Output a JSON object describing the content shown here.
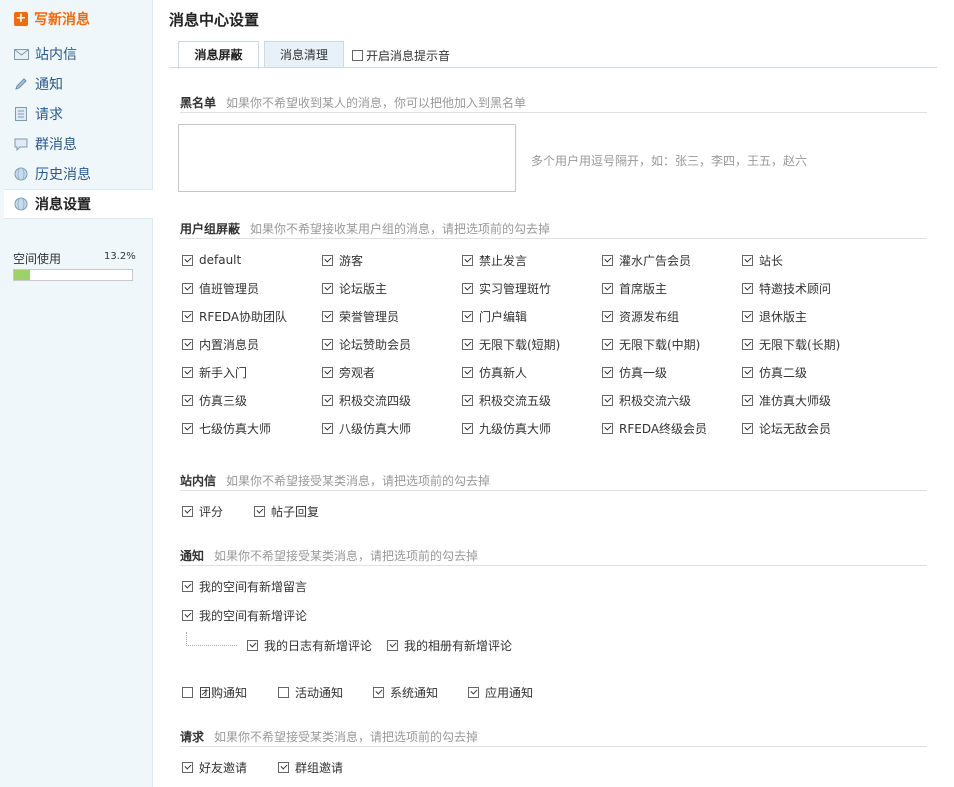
{
  "sidebar": {
    "compose_label": "写新消息",
    "items": [
      {
        "label": "站内信",
        "icon": "envelope-icon"
      },
      {
        "label": "通知",
        "icon": "pencil-icon"
      },
      {
        "label": "请求",
        "icon": "document-icon"
      },
      {
        "label": "群消息",
        "icon": "speech-bubble-icon"
      },
      {
        "label": "历史消息",
        "icon": "globe-icon"
      },
      {
        "label": "消息设置",
        "icon": "globe-icon"
      }
    ],
    "space": {
      "label": "空间使用",
      "percent_text": "13.2%",
      "percent": 13.2
    }
  },
  "main": {
    "title": "消息中心设置",
    "tabs": [
      {
        "label": "消息屏蔽"
      },
      {
        "label": "消息清理"
      }
    ],
    "sound_label": "开启消息提示音",
    "blacklist": {
      "title": "黑名单",
      "desc": "如果你不希望收到某人的消息，你可以把他加入到黑名单",
      "hint": "多个用户用逗号隔开，如：张三，李四，王五，赵六"
    },
    "group_block": {
      "title": "用户组屏蔽",
      "desc": "如果你不希望接收某用户组的消息，请把选项前的勾去掉",
      "rows": [
        [
          "default",
          "游客",
          "禁止发言",
          "灌水广告会员",
          "站长"
        ],
        [
          "值班管理员",
          "论坛版主",
          "实习管理斑竹",
          "首席版主",
          "特邀技术顾问"
        ],
        [
          "RFEDA协助团队",
          "荣誉管理员",
          "门户编辑",
          "资源发布组",
          "退休版主"
        ],
        [
          "内置消息员",
          "论坛赞助会员",
          "无限下载(短期)",
          "无限下载(中期)",
          "无限下载(长期)"
        ],
        [
          "新手入门",
          "旁观者",
          "仿真新人",
          "仿真一级",
          "仿真二级"
        ],
        [
          "仿真三级",
          "积极交流四级",
          "积极交流五级",
          "积极交流六级",
          "准仿真大师级"
        ],
        [
          "七级仿真大师",
          "八级仿真大师",
          "九级仿真大师",
          "RFEDA终级会员",
          "论坛无敌会员"
        ]
      ]
    },
    "site_msg": {
      "title": "站内信",
      "desc": "如果你不希望接受某类消息，请把选项前的勾去掉",
      "options": [
        {
          "label": "评分",
          "checked": true
        },
        {
          "label": "帖子回复",
          "checked": true
        }
      ]
    },
    "notice": {
      "title": "通知",
      "desc": "如果你不希望接受某类消息，请把选项前的勾去掉",
      "opt1": "我的空间有新增留言",
      "opt2": "我的空间有新增评论",
      "sub": [
        {
          "label": "我的日志有新增评论",
          "checked": true
        },
        {
          "label": "我的相册有新增评论",
          "checked": true
        }
      ],
      "bottom": [
        {
          "label": "团购通知",
          "checked": false
        },
        {
          "label": "活动通知",
          "checked": false
        },
        {
          "label": "系统通知",
          "checked": true
        },
        {
          "label": "应用通知",
          "checked": true
        }
      ]
    },
    "request": {
      "title": "请求",
      "desc": "如果你不希望接受某类消息，请把选项前的勾去掉",
      "options": [
        {
          "label": "好友邀请",
          "checked": true
        },
        {
          "label": "群组邀请",
          "checked": true
        }
      ]
    }
  },
  "colors": {
    "accent": "#f06a0e",
    "link": "#2b5a8a",
    "sidebar_bg": "#f0f7fb",
    "progress": "#9cd26a"
  }
}
